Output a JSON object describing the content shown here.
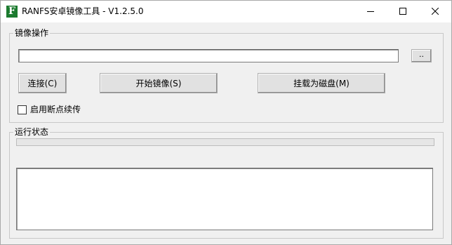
{
  "window": {
    "title": "RANFS安卓镜像工具 - V1.2.5.0",
    "app_icon_letter": "F",
    "app_icon_color": "#1b7a2e",
    "caption_buttons": [
      "minimize-icon",
      "maximize-icon",
      "close-icon"
    ]
  },
  "image_group": {
    "label": "镜像操作",
    "path_value": "",
    "browse_label": "..",
    "connect_label": "连接(C)",
    "start_label": "开始镜像(S)",
    "mount_label": "挂载为磁盘(M)",
    "resume_checkbox": {
      "label": "启用断点续传",
      "checked": false
    }
  },
  "status_group": {
    "label": "运行状态",
    "progress": 0,
    "progress_color": "#06b025",
    "log_text": ""
  }
}
